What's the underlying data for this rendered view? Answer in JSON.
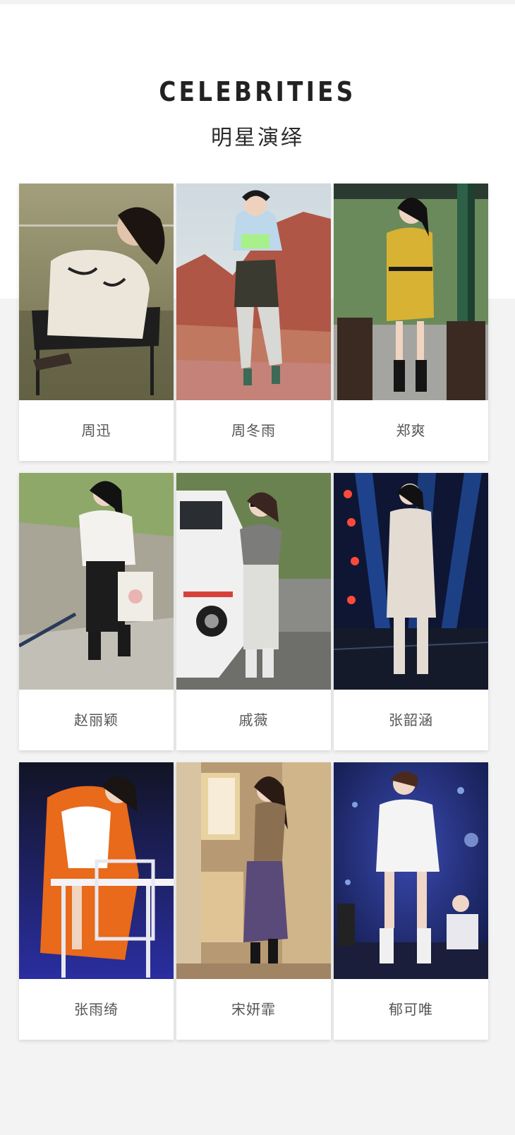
{
  "header": {
    "title": "CELEBRITIES",
    "subtitle": "明星演绎"
  },
  "celebrities": [
    {
      "name": "周迅",
      "scene": "lakeside-chair",
      "colors": {
        "bg": "#8c8a64",
        "outfit": "#ece6da",
        "accent": "#1e1e1e"
      }
    },
    {
      "name": "周冬雨",
      "scene": "red-mountains",
      "colors": {
        "bg": "#b65a4e",
        "outfit": "#3a3a30",
        "accent": "#bcd8ea"
      }
    },
    {
      "name": "郑爽",
      "scene": "garden-pavilion",
      "colors": {
        "bg": "#5f7a56",
        "outfit": "#d8b232",
        "accent": "#2d6046"
      }
    },
    {
      "name": "赵丽颖",
      "scene": "stone-stairs",
      "colors": {
        "bg": "#9c9a8a",
        "outfit": "#f4f2ee",
        "accent": "#1c1c1c"
      }
    },
    {
      "name": "戚薇",
      "scene": "white-suv",
      "colors": {
        "bg": "#6a8250",
        "outfit": "#dededa",
        "accent": "#f0f0f0"
      }
    },
    {
      "name": "张韶涵",
      "scene": "stage-lights",
      "colors": {
        "bg": "#101a3a",
        "outfit": "#e4dcd2",
        "accent": "#2b6ad6"
      }
    },
    {
      "name": "张雨绮",
      "scene": "orange-fur-studio",
      "colors": {
        "bg": "#22224a",
        "outfit": "#e86a1a",
        "accent": "#ffffff"
      }
    },
    {
      "name": "宋妍霏",
      "scene": "dressing-room",
      "colors": {
        "bg": "#b79a74",
        "outfit": "#5a4a7a",
        "accent": "#e8d2a0"
      }
    },
    {
      "name": "郁可唯",
      "scene": "blue-stage",
      "colors": {
        "bg": "#1e2a6a",
        "outfit": "#f4f4f4",
        "accent": "#7fa0e0"
      }
    }
  ]
}
